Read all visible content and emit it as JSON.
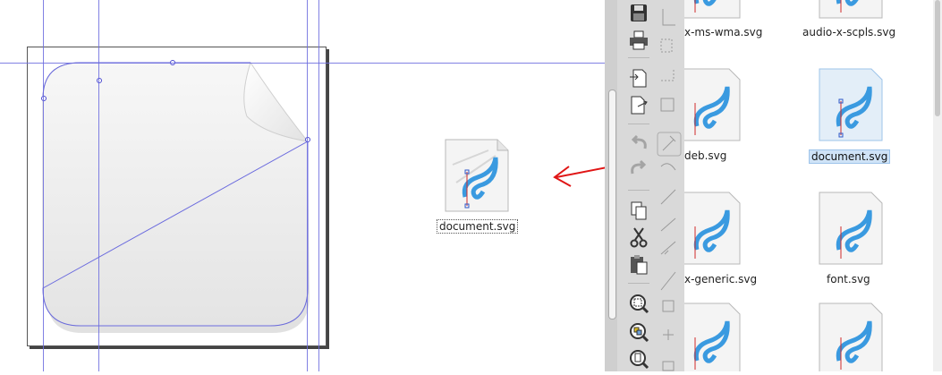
{
  "desktop_file": {
    "label": "document.svg"
  },
  "file_manager": {
    "files": [
      {
        "label": "x-ms-wma.svg"
      },
      {
        "label": "audio-x-scpls.svg"
      },
      {
        "label": "deb.svg"
      },
      {
        "label": "document.svg",
        "selected": true
      },
      {
        "label": "x-generic.svg"
      },
      {
        "label": "font.svg"
      }
    ]
  },
  "toolbar": {
    "buttons": [
      {
        "icon": "save-icon"
      },
      {
        "icon": "print-icon"
      },
      {
        "icon": "import-icon"
      },
      {
        "icon": "export-icon"
      },
      {
        "icon": "undo-icon"
      },
      {
        "icon": "redo-icon"
      },
      {
        "icon": "copy-icon"
      },
      {
        "icon": "cut-icon"
      },
      {
        "icon": "paste-icon"
      },
      {
        "icon": "zoom-selection-icon"
      },
      {
        "icon": "zoom-drawing-icon"
      },
      {
        "icon": "zoom-page-icon"
      }
    ]
  },
  "colors": {
    "guide": "#6b6bde",
    "arrow": "#e01515",
    "selection": "#cfe3f7"
  }
}
